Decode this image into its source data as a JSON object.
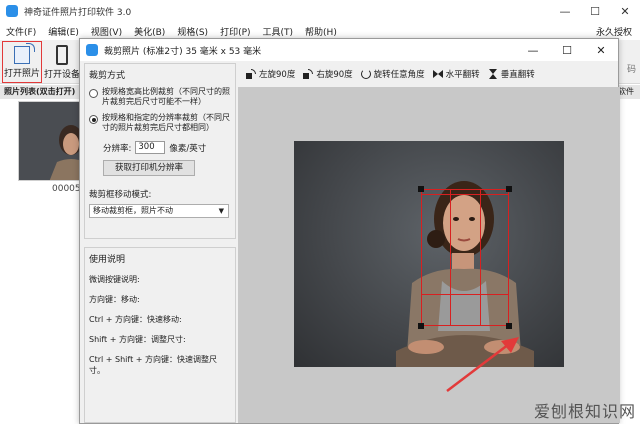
{
  "app": {
    "title": "神奇证件照片打印软件 3.0",
    "controls": {
      "minimize": "—",
      "maximize": "☐",
      "close": "✕"
    },
    "menu": [
      "文件(F)",
      "编辑(E)",
      "视图(V)",
      "美化(B)",
      "规格(S)",
      "打印(P)",
      "工具(T)",
      "帮助(H)"
    ],
    "license_text": "永久授权"
  },
  "toolbar": {
    "open_photo": "打开照片",
    "open_device": "打开设备"
  },
  "photo_list": {
    "header": "照片列表(双击打开)",
    "right_header": "软件",
    "thumb_label": "00005"
  },
  "right_toolbar_label": "码",
  "dialog": {
    "title": "裁剪照片 (标准2寸) 35 毫米 x 53 毫米",
    "controls": {
      "minimize": "—",
      "maximize": "☐",
      "close": "✕"
    },
    "crop_mode": {
      "group_title": "裁剪方式",
      "option1": "按规格宽高比例裁剪（不同尺寸的照片裁剪完后尺寸可能不一样）",
      "option2": "按规格和指定的分辨率裁剪（不同尺寸的照片裁剪完后尺寸都相同）",
      "selected": 2,
      "resolution_label": "分辨率:",
      "resolution_value": "300",
      "resolution_unit": "像素/英寸",
      "get_printer_resolution": "获取打印机分辨率",
      "move_mode_label": "裁剪框移动模式:",
      "move_mode_value": "移动裁剪框，照片不动"
    },
    "help": {
      "group_title": "使用说明",
      "lines": [
        "微调按键说明:",
        "方向键：移动:",
        "Ctrl + 方向键：快速移动:",
        "Shift + 方向键：调整尺寸:",
        "Ctrl + Shift + 方向键：快速调整尺寸。"
      ]
    },
    "tools": {
      "rotate_left": "左旋90度",
      "rotate_right": "右旋90度",
      "rotate_any": "旋转任意角度",
      "flip_h": "水平翻转",
      "flip_v": "垂直翻转"
    }
  },
  "watermark": "爱刨根知识网",
  "colors": {
    "accent": "#2b8fe8",
    "crop_line": "#d82020",
    "highlight": "#e23a3a"
  }
}
